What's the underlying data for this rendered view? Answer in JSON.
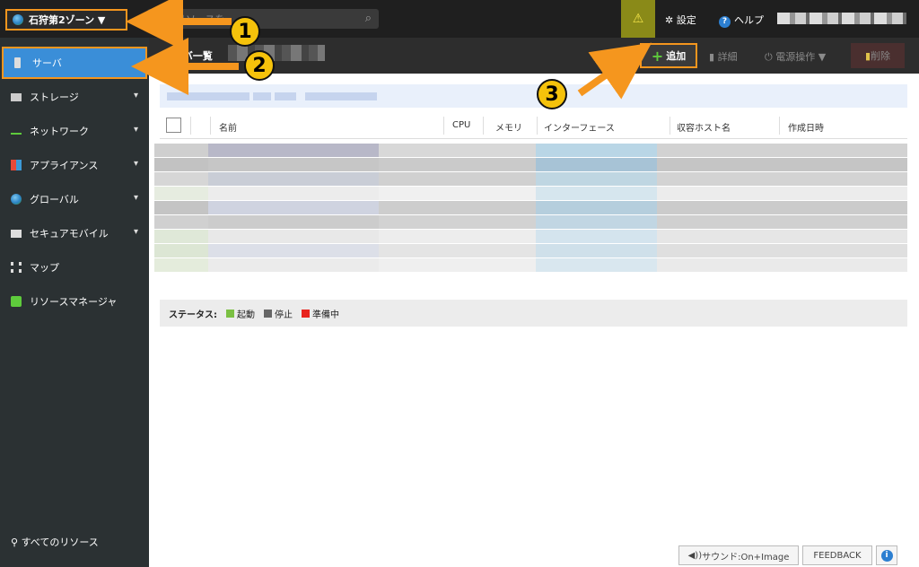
{
  "topbar": {
    "zone": "石狩第2ゾーン ▼",
    "search_placeholder": "リソースを",
    "warning_icon": "warning-icon",
    "settings_label": "設定",
    "help_label": "ヘルプ"
  },
  "sidebar": {
    "items": [
      {
        "label": "サーバ",
        "icon": "server-icon",
        "active": true
      },
      {
        "label": "ストレージ",
        "icon": "storage-icon",
        "chevron": true
      },
      {
        "label": "ネットワーク",
        "icon": "network-icon",
        "chevron": true
      },
      {
        "label": "アプライアンス",
        "icon": "appliance-icon",
        "chevron": true
      },
      {
        "label": "グローバル",
        "icon": "globe-icon",
        "chevron": true
      },
      {
        "label": "セキュアモバイル",
        "icon": "secure-mobile-icon",
        "chevron": true
      },
      {
        "label": "マップ",
        "icon": "map-icon"
      },
      {
        "label": "リソースマネージャ",
        "icon": "resource-manager-icon"
      }
    ],
    "bottom_label": "すべてのリソース"
  },
  "header": {
    "title": "サーバ一覧",
    "add_label": "追加",
    "detail_label": "詳細",
    "power_label": "電源操作 ▼",
    "delete_label": "削除"
  },
  "table": {
    "columns": [
      "名前",
      "CPU",
      "メモリ",
      "インターフェース",
      "収容ホスト名",
      "作成日時"
    ]
  },
  "status": {
    "label": "ステータス:",
    "items": [
      {
        "label": "起動",
        "color": "#7bc043"
      },
      {
        "label": "停止",
        "color": "#666666"
      },
      {
        "label": "準備中",
        "color": "#e8231e"
      }
    ]
  },
  "footer": {
    "sound_label": "サウンド:On+Image",
    "feedback_label": "FEEDBACK"
  },
  "annotations": [
    "1",
    "2",
    "3"
  ],
  "colors": {
    "accent": "#f5961e",
    "badge": "#f5c20b",
    "active": "#3a8ed8"
  }
}
